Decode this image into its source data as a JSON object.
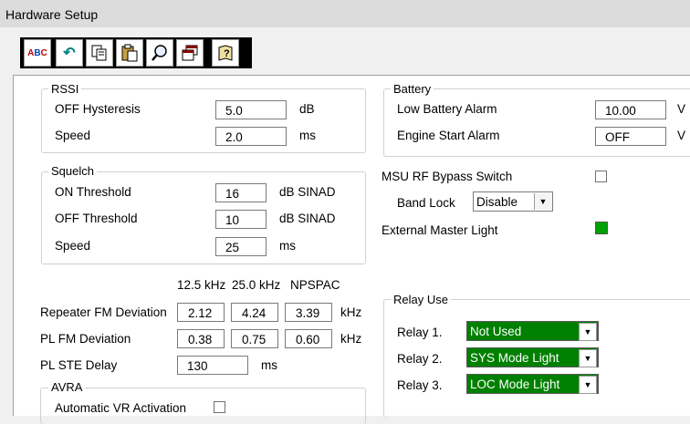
{
  "window": {
    "title": "Hardware Setup"
  },
  "toolbar": {
    "buttons": [
      {
        "name": "spellcheck-icon",
        "glyph": "ABC"
      },
      {
        "name": "undo-icon",
        "glyph": "↶"
      },
      {
        "name": "copy-icon",
        "glyph": "⧉"
      },
      {
        "name": "paste-icon",
        "glyph": "📋"
      },
      {
        "name": "find-icon",
        "glyph": "🔍"
      },
      {
        "name": "window-icon",
        "glyph": "❐"
      },
      {
        "name": "help-book-icon",
        "glyph": "?"
      }
    ]
  },
  "rssi": {
    "legend": "RSSI",
    "off_hysteresis": {
      "label": "OFF Hysteresis",
      "value": "5.0",
      "unit": "dB"
    },
    "speed": {
      "label": "Speed",
      "value": "2.0",
      "unit": "ms"
    }
  },
  "squelch": {
    "legend": "Squelch",
    "on_threshold": {
      "label": "ON Threshold",
      "value": "16",
      "unit": "dB SINAD"
    },
    "off_threshold": {
      "label": "OFF Threshold",
      "value": "10",
      "unit": "dB SINAD"
    },
    "speed": {
      "label": "Speed",
      "value": "25",
      "unit": "ms"
    }
  },
  "deviation": {
    "col_headers": [
      "12.5 kHz",
      "25.0 kHz",
      "NPSPAC"
    ],
    "repeater": {
      "label": "Repeater FM Deviation",
      "values": [
        "2.12",
        "4.24",
        "3.39"
      ],
      "unit": "kHz"
    },
    "pl": {
      "label": "PL FM Deviation",
      "values": [
        "0.38",
        "0.75",
        "0.60"
      ],
      "unit": "kHz"
    },
    "pl_ste": {
      "label": "PL STE Delay",
      "value": "130",
      "unit": "ms"
    }
  },
  "avra": {
    "legend": "AVRA",
    "auto_vr": {
      "label": "Automatic VR Activation",
      "checked": false
    }
  },
  "battery": {
    "legend": "Battery",
    "low_alarm": {
      "label": "Low Battery Alarm",
      "value": "10.00",
      "unit": "V"
    },
    "engine_alarm": {
      "label": "Engine Start Alarm",
      "value": "OFF",
      "unit": "V"
    }
  },
  "msu": {
    "label": "MSU RF Bypass Switch",
    "checked": false
  },
  "band_lock": {
    "label": "Band Lock",
    "value": "Disable"
  },
  "ext_light": {
    "label": "External Master Light",
    "color": "#00a000"
  },
  "relay": {
    "legend": "Relay Use",
    "relays": [
      {
        "label": "Relay 1.",
        "value": "Not Used"
      },
      {
        "label": "Relay 2.",
        "value": "SYS Mode Light"
      },
      {
        "label": "Relay 3.",
        "value": "LOC Mode Light"
      }
    ]
  }
}
